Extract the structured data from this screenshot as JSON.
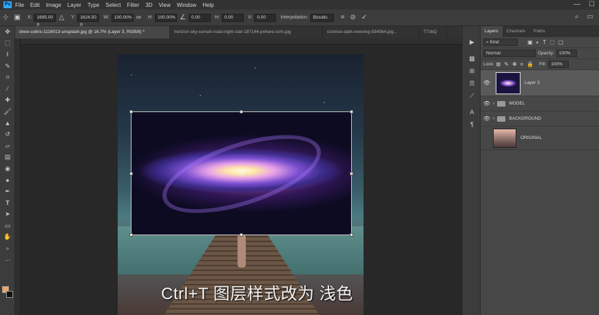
{
  "app": {
    "menu": [
      "File",
      "Edit",
      "Image",
      "Layer",
      "Type",
      "Select",
      "Filter",
      "3D",
      "View",
      "Window",
      "Help"
    ]
  },
  "options_bar": {
    "x_label": "X:",
    "x_value": "1695.00 p",
    "y_label": "Y:",
    "y_value": "1624.50 p",
    "w_label": "W:",
    "w_value": "100.00%",
    "h_label": "H:",
    "h_value": "100.00%",
    "rotate_value": "0.00",
    "hskew_label": "H:",
    "hskew_value": "0.00",
    "vskew_label": "V:",
    "vskew_value": "0.00",
    "interpolation_label": "Interpolation:",
    "interpolation_value": "Bicubic"
  },
  "tabs": [
    {
      "label": "drew-colins-1116013-unsplash.jpg @ 16.7% (Layer 3, RGB/8) *"
    },
    {
      "label": "horizon-sky-sunset-road-night-star-187144-pxhere.com.jpg"
    },
    {
      "label": "cosmos-dark-evening-934564.jpg..."
    },
    {
      "label": "T7zbQ"
    }
  ],
  "subtitle": "Ctrl+T   图层样式改为 浅色",
  "layers_panel": {
    "tabs": [
      "Layers",
      "Channels",
      "Paths"
    ],
    "kind_label": "Kind",
    "blend_mode": "Normal",
    "opacity_label": "Opacity:",
    "opacity_value": "100%",
    "lock_label": "Lock:",
    "fill_label": "Fill:",
    "fill_value": "100%",
    "layers": [
      {
        "name": "Layer 3"
      },
      {
        "name": "MODEL"
      },
      {
        "name": "BACKGROUND"
      },
      {
        "name": "ORIGINAL"
      }
    ]
  },
  "colors": {
    "foreground": "#f4a460",
    "background": "#111111",
    "ui_dark": "#323232",
    "ui_panel": "#474747"
  }
}
